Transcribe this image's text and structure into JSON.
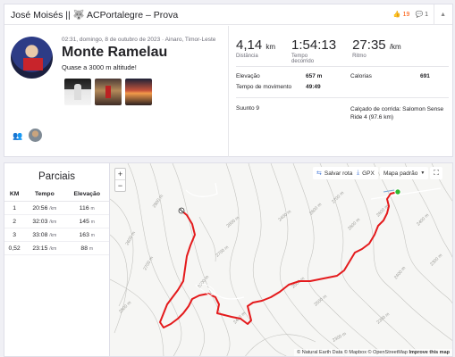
{
  "header": {
    "title": "José Moisés || 🐺 ACPortalegre – Prova",
    "kudos": "19",
    "comments": "1"
  },
  "activity": {
    "meta": "02:31, domingo, 8 de outubro de 2023 · Ainaro, Timor-Leste",
    "title": "Monte Ramelau",
    "description": "Quase a 3000 m altitude!",
    "stats": [
      {
        "value": "4,14",
        "unit": "km",
        "label": "Distância"
      },
      {
        "value": "1:54:13",
        "unit": "",
        "label": "Tempo decorrido"
      },
      {
        "value": "27:35",
        "unit": "/km",
        "label": "Ritmo"
      }
    ],
    "details": {
      "elev_label": "Elevação",
      "elev_value": "657 m",
      "cal_label": "Calorias",
      "cal_value": "691",
      "moving_label": "Tempo de movimento",
      "moving_value": "49:49",
      "device": "Suunto 9",
      "shoes": "Calçado de corrida: Salomon Sense Ride 4 (97.6 km)"
    }
  },
  "splits": {
    "title": "Parciais",
    "columns": [
      "KM",
      "Tempo",
      "Elevação"
    ],
    "rows": [
      {
        "km": "1",
        "time": "20:56",
        "time_unit": "/km",
        "elev": "116",
        "elev_unit": "m"
      },
      {
        "km": "2",
        "time": "32:03",
        "time_unit": "/km",
        "elev": "145",
        "elev_unit": "m"
      },
      {
        "km": "3",
        "time": "33:08",
        "time_unit": "/km",
        "elev": "163",
        "elev_unit": "m"
      },
      {
        "km": "0,52",
        "time": "23:15",
        "time_unit": "/km",
        "elev": "88",
        "elev_unit": "m"
      }
    ]
  },
  "map": {
    "zoom_in": "+",
    "zoom_out": "−",
    "save_route": "Salvar rota",
    "gpx": "GPX",
    "map_style": "Mapa padrão",
    "contour_labels": [
      "2800 m",
      "2600 m",
      "2700 m",
      "2500 m",
      "2800 m",
      "2700 m",
      "2500 m",
      "2400 m",
      "2400 m",
      "2600 m",
      "2700 m",
      "2600 m",
      "2600 m",
      "2500 m",
      "2500 m",
      "2400 m",
      "2400 m",
      "2300 m",
      "2300 m",
      "2300 m"
    ],
    "attribution": "© Natural Earth Data © Mapbox © OpenStreetMap",
    "improve": "Improve this map",
    "route_color": "#e41a1c"
  }
}
